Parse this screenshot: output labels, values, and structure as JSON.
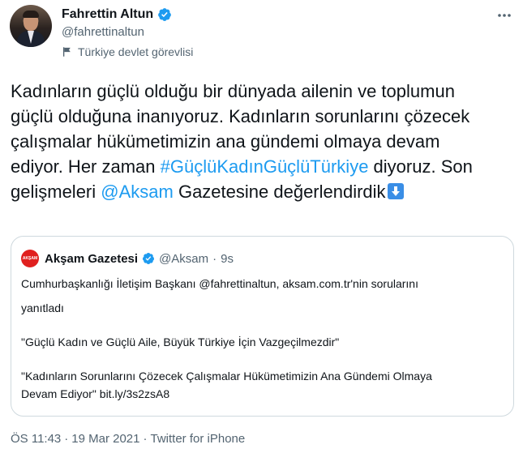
{
  "author": {
    "name": "Fahrettin Altun",
    "handle": "@fahrettinaltun",
    "label": "Türkiye devlet görevlisi",
    "verified": true
  },
  "tweet": {
    "text_before_hashtag": "Kadınların güçlü olduğu bir dünyada ailenin ve toplumun güçlü olduğuna inanıyoruz. Kadınların sorunlarını çözecek çalışmalar hükümetimizin ana gündemi olmaya devam ediyor. Her zaman ",
    "hashtag": "#GüçlüKadınGüçlüTürkiye",
    "text_mid": " diyoruz. Son gelişmeleri ",
    "mention": "@Aksam",
    "text_after": " Gazetesine değerlendirdik",
    "emoji": "down-arrow-emoji"
  },
  "quoted_tweet": {
    "logo_text": "AKŞAM",
    "name": "Akşam Gazetesi",
    "handle": "@Aksam",
    "separator": "·",
    "time": "9s",
    "line1": "Cumhurbaşkanlığı İletişim Başkanı @fahrettinaltun, aksam.com.tr'nin sorularını",
    "line2": "yanıtladı",
    "line3": "\"Güçlü Kadın ve Güçlü Aile, Büyük Türkiye İçin Vazgeçilmezdir\"",
    "line4": "\"Kadınların Sorunlarını Çözecek Çalışmalar Hükümetimizin Ana Gündemi Olmaya",
    "line5": "Devam Ediyor\" bit.ly/3s2zsA8"
  },
  "footer": {
    "time": "ÖS 11:43",
    "sep1": "·",
    "date": "19 Mar 2021",
    "sep2": "·",
    "source": "Twitter for iPhone"
  },
  "colors": {
    "link": "#1d9bf0",
    "secondary_text": "#536471",
    "border": "#cfd9de",
    "brand_red": "#e0201f"
  },
  "icons": [
    "verified-badge-icon",
    "government-flag-icon",
    "more-options-icon",
    "down-arrow-emoji"
  ]
}
